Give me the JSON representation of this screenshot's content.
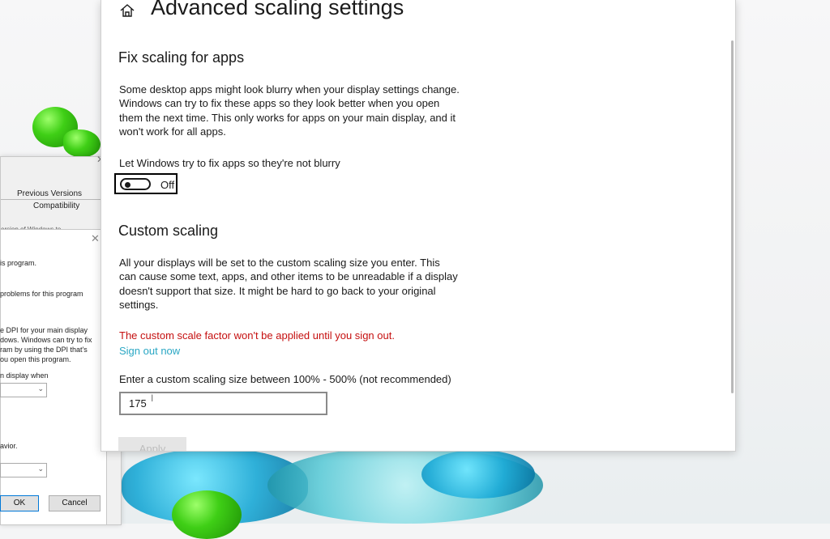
{
  "background_dialog": {
    "tab_previous_versions": "Previous Versions",
    "tab_compatibility": "Compatibility",
    "line_partial": "ersion of Windows to",
    "line_program": "is program.",
    "line_problems": "problems for this program",
    "dpi_text": [
      "e DPI for your main display",
      "dows. Windows can try to fix",
      "ram by using the DPI that's",
      "ou open this program."
    ],
    "display_when": "n display when",
    "behavior": "avior.",
    "ok_label": "OK",
    "cancel_label": "Cancel"
  },
  "settings": {
    "page_title": "Advanced scaling settings",
    "fix_section": {
      "heading": "Fix scaling for apps",
      "description": "Some desktop apps might look blurry when your display settings change. Windows can try to fix these apps so they look better when you open them the next time. This only works for apps on your main display, and it won't work for all apps.",
      "toggle_label": "Let Windows try to fix apps so they're not blurry",
      "toggle_state": "Off"
    },
    "custom_section": {
      "heading": "Custom scaling",
      "description": "All your displays will be set to the custom scaling size you enter. This can cause some text, apps, and other items to be unreadable if a display doesn't support that size. It might be hard to go back to your original settings.",
      "warning": "The custom scale factor won't be applied until you sign out.",
      "sign_out_link": "Sign out now",
      "input_label": "Enter a custom scaling size between 100% - 500% (not recommended)",
      "input_value": "175",
      "apply_label": "Apply"
    }
  },
  "colors": {
    "accent_link": "#2aa7c4",
    "warning_red": "#c50f0f"
  }
}
